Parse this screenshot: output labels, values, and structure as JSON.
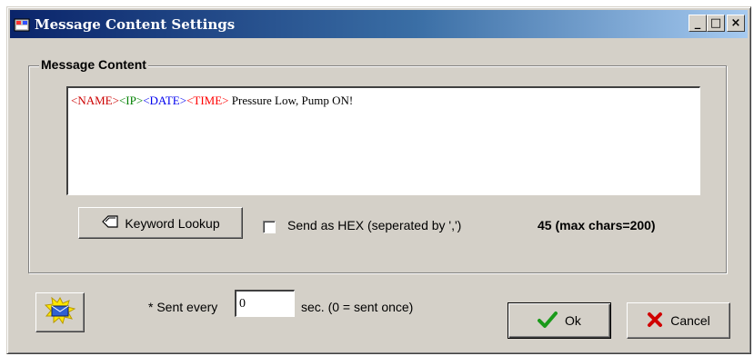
{
  "window": {
    "title": "Message Content Settings",
    "minimize_label": "_",
    "maximize_label": "□",
    "close_label": "×"
  },
  "group": {
    "legend": "Message Content"
  },
  "message": {
    "segments": [
      {
        "text": "<NAME>",
        "color": "#cc0000"
      },
      {
        "text": "<IP>",
        "color": "#008000"
      },
      {
        "text": "<DATE>",
        "color": "#0000ee"
      },
      {
        "text": "<TIME>",
        "color": "#ff0000"
      },
      {
        "text": " Pressure Low, Pump ON!",
        "color": "#000000"
      }
    ]
  },
  "keyword_button": {
    "label": "Keyword Lookup",
    "icon": "tag-icon"
  },
  "hex_checkbox": {
    "label": "Send as HEX (seperated by ',')",
    "checked": false
  },
  "char_count": "45 (max chars=200)",
  "repeat": {
    "prefix": "* Sent every",
    "value": "0",
    "suffix": "sec. (0 = sent once)"
  },
  "send_button": {
    "icon": "send-envelope-icon"
  },
  "ok_button": {
    "label": "Ok",
    "icon": "checkmark-icon"
  },
  "cancel_button": {
    "label": "Cancel",
    "icon": "red-x-icon"
  }
}
